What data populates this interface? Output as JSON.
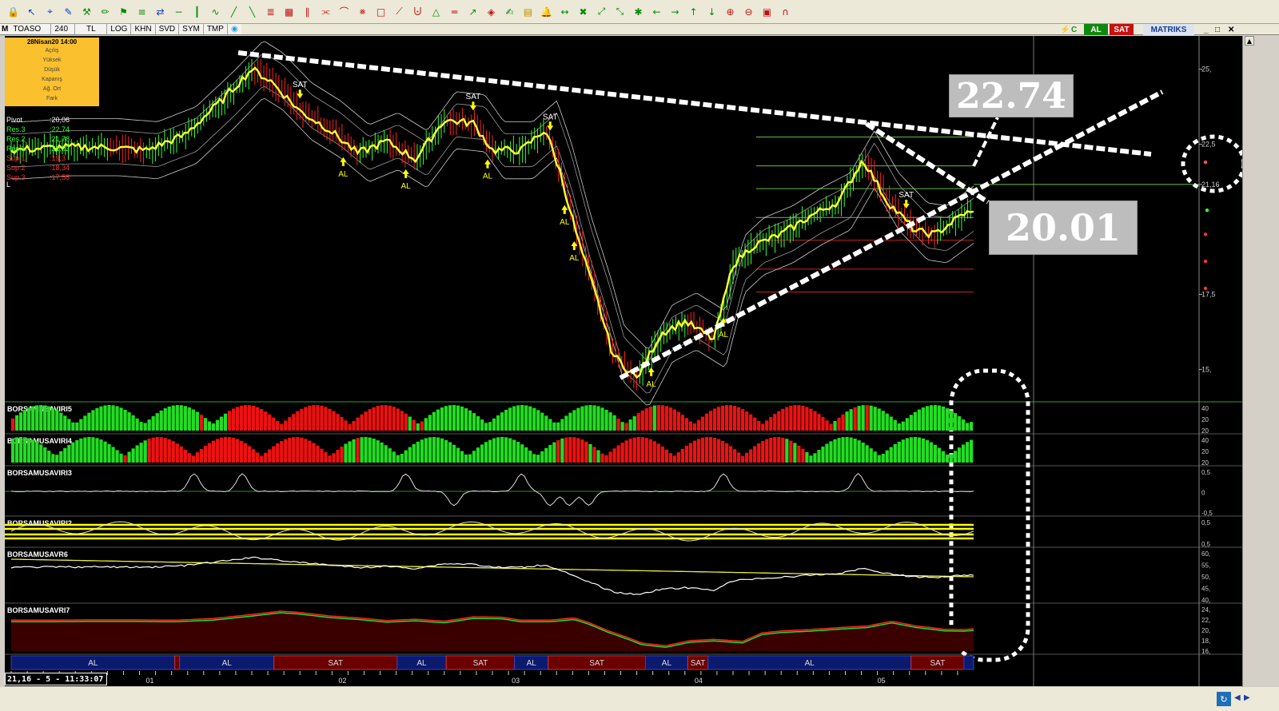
{
  "toolbar": {
    "icons": [
      "lock-icon",
      "cursor-icon",
      "crosshair-icon",
      "edit-icon",
      "tools-icon",
      "pencil-icon",
      "tag-icon",
      "align-icon",
      "arrows-icon",
      "minus-icon",
      "vline-icon",
      "curve-icon",
      "brush-icon",
      "diagonal-icon",
      "fibo-icon",
      "grid-icon",
      "channel-icon",
      "fan-icon",
      "arc-icon",
      "gann-icon",
      "box-icon",
      "ray-icon",
      "pitchfork-icon",
      "triangle-icon",
      "level-icon",
      "arrow-icon",
      "shapes-icon",
      "pencil2-icon",
      "note-icon",
      "bell-icon",
      "expand-h-icon",
      "expand-x-icon",
      "fit-icon",
      "fit2-icon",
      "gear-icon",
      "left-icon",
      "right-icon",
      "up-icon",
      "down-icon",
      "zoom-in-icon",
      "zoom-out-icon",
      "image-icon",
      "magnet-icon"
    ]
  },
  "subbar": {
    "symbol": "TOASO",
    "period": "240",
    "currency": "TL",
    "buttons": [
      "LOG",
      "KHN",
      "SVD",
      "SYM",
      "TMP"
    ],
    "right_buttons": {
      "al": "AL",
      "sat": "SAT",
      "brand": "MATRIKS"
    }
  },
  "infobox": {
    "date": "28Nisan20 14:00",
    "rows": [
      "Açılış",
      "Yüksek",
      "Düşük",
      "Kapanış",
      "Ağ. Ort",
      "Fark"
    ]
  },
  "pivots": [
    {
      "label": "Pivot",
      "value": ":20,06",
      "color": "#ffffff"
    },
    {
      "label": "Res.3",
      "value": ":22,74",
      "color": "#33ff33"
    },
    {
      "label": "Res.2",
      "value": ":21,78",
      "color": "#33ff33"
    },
    {
      "label": "Res.1",
      "value": ":21,02",
      "color": "#33ff33"
    },
    {
      "label": "Sup.1",
      "value": ":19,3",
      "color": "#ff3333"
    },
    {
      "label": "Sup.2",
      "value": ":18,34",
      "color": "#ff3333"
    },
    {
      "label": "Sup.3",
      "value": ":17,58",
      "color": "#ff3333"
    }
  ],
  "pivot_extra": "L",
  "callouts": {
    "upper": "22.74",
    "lower": "20.01"
  },
  "current_price_label": "21,16",
  "status": {
    "time": "21,16 - 5 - 11:33:07"
  },
  "indicators": [
    {
      "name": "BORSAMUSAVIRI5",
      "ticks": [
        "40",
        "20",
        "20"
      ]
    },
    {
      "name": "BORSAMUSAVIRI4",
      "ticks": [
        "40",
        "20",
        "20"
      ]
    },
    {
      "name": "BORSAMUSAVIRI3",
      "ticks": [
        "0,5",
        "0",
        "-0,5"
      ]
    },
    {
      "name": "BORSAMUSAVIRI2",
      "ticks": [
        "0,5",
        "0,5"
      ]
    },
    {
      "name": "BORSAMUSAVR6",
      "ticks": [
        "60,",
        "55,",
        "50,",
        "45,",
        "40,"
      ]
    },
    {
      "name": "BORSAMUSAVRI7",
      "ticks": [
        "24,",
        "22,",
        "20,",
        "18,",
        "16,"
      ]
    }
  ],
  "signal_bar": [
    {
      "label": "AL",
      "type": "AL",
      "from": 0,
      "to": 0.17
    },
    {
      "label": "",
      "type": "SAT",
      "from": 0.17,
      "to": 0.175
    },
    {
      "label": "AL",
      "type": "AL",
      "from": 0.175,
      "to": 0.273
    },
    {
      "label": "SAT",
      "type": "SAT",
      "from": 0.273,
      "to": 0.401
    },
    {
      "label": "AL",
      "type": "AL",
      "from": 0.401,
      "to": 0.452
    },
    {
      "label": "SAT",
      "type": "SAT",
      "from": 0.452,
      "to": 0.523
    },
    {
      "label": "AL",
      "type": "AL",
      "from": 0.523,
      "to": 0.558
    },
    {
      "label": "SAT",
      "type": "SAT",
      "from": 0.558,
      "to": 0.659
    },
    {
      "label": "AL",
      "type": "AL",
      "from": 0.659,
      "to": 0.703
    },
    {
      "label": "SAT",
      "type": "SAT",
      "from": 0.703,
      "to": 0.724
    },
    {
      "label": "AL",
      "type": "AL",
      "from": 0.724,
      "to": 0.935
    },
    {
      "label": "SAT",
      "type": "SAT",
      "from": 0.935,
      "to": 0.99
    },
    {
      "label": "",
      "type": "AL",
      "from": 0.99,
      "to": 1
    }
  ],
  "chart_data": {
    "type": "candlestick",
    "title": "",
    "xlabel": "",
    "ylabel": "",
    "ylim": [
      14,
      26
    ],
    "yticks": [
      "25,",
      "22,5",
      "21,16",
      "17,5",
      "15,"
    ],
    "xticks": [
      "01",
      "02",
      "03",
      "04",
      "05"
    ],
    "x_tick_positions": [
      0.14,
      0.34,
      0.52,
      0.71,
      0.9
    ],
    "close_trend": [
      [
        0.0,
        22.3
      ],
      [
        0.05,
        22.4
      ],
      [
        0.1,
        22.4
      ],
      [
        0.14,
        22.3
      ],
      [
        0.18,
        22.8
      ],
      [
        0.22,
        24.0
      ],
      [
        0.25,
        25.0
      ],
      [
        0.27,
        24.6
      ],
      [
        0.3,
        23.6
      ],
      [
        0.33,
        23.0
      ],
      [
        0.36,
        22.2
      ],
      [
        0.39,
        22.6
      ],
      [
        0.42,
        22.0
      ],
      [
        0.45,
        23.3
      ],
      [
        0.48,
        23.2
      ],
      [
        0.5,
        22.3
      ],
      [
        0.53,
        22.3
      ],
      [
        0.555,
        23.0
      ],
      [
        0.57,
        21.6
      ],
      [
        0.59,
        19.2
      ],
      [
        0.61,
        17.2
      ],
      [
        0.625,
        15.5
      ],
      [
        0.65,
        14.7
      ],
      [
        0.675,
        16.2
      ],
      [
        0.7,
        16.6
      ],
      [
        0.73,
        16.0
      ],
      [
        0.75,
        18.5
      ],
      [
        0.77,
        19.1
      ],
      [
        0.8,
        19.5
      ],
      [
        0.83,
        20.1
      ],
      [
        0.86,
        20.6
      ],
      [
        0.885,
        22.0
      ],
      [
        0.91,
        20.6
      ],
      [
        0.94,
        19.6
      ],
      [
        0.96,
        19.5
      ],
      [
        0.99,
        20.2
      ]
    ],
    "signals": [
      {
        "x": 0.3,
        "label": "SAT",
        "dir": "down"
      },
      {
        "x": 0.345,
        "label": "AL",
        "dir": "up"
      },
      {
        "x": 0.41,
        "label": "AL",
        "dir": "up"
      },
      {
        "x": 0.48,
        "label": "SAT",
        "dir": "down"
      },
      {
        "x": 0.495,
        "label": "AL",
        "dir": "up"
      },
      {
        "x": 0.56,
        "label": "SAT",
        "dir": "down"
      },
      {
        "x": 0.575,
        "label": "AL",
        "dir": "up"
      },
      {
        "x": 0.585,
        "label": "AL",
        "dir": "up"
      },
      {
        "x": 0.665,
        "label": "AL",
        "dir": "up"
      },
      {
        "x": 0.74,
        "label": "AL",
        "dir": "up"
      },
      {
        "x": 0.93,
        "label": "SAT",
        "dir": "down"
      }
    ],
    "pivot_levels": [
      {
        "value": 22.74,
        "color": "#66bb44"
      },
      {
        "value": 21.78,
        "color": "#66bb44"
      },
      {
        "value": 21.02,
        "color": "#66bb44"
      },
      {
        "value": 20.06,
        "color": "#999999"
      },
      {
        "value": 19.3,
        "color": "#cc2222"
      },
      {
        "value": 18.34,
        "color": "#cc2222"
      },
      {
        "value": 17.58,
        "color": "#cc2222"
      }
    ]
  },
  "colors": {
    "up": "#33ff33",
    "down": "#ff2222",
    "ma": "#ffff33",
    "band": "#cccccc",
    "trend": "#ffffff",
    "callout": "#bdbdbd",
    "infobox": "#fbc02d",
    "alfill": "#0c1a6e",
    "satfill": "#6a0000"
  }
}
